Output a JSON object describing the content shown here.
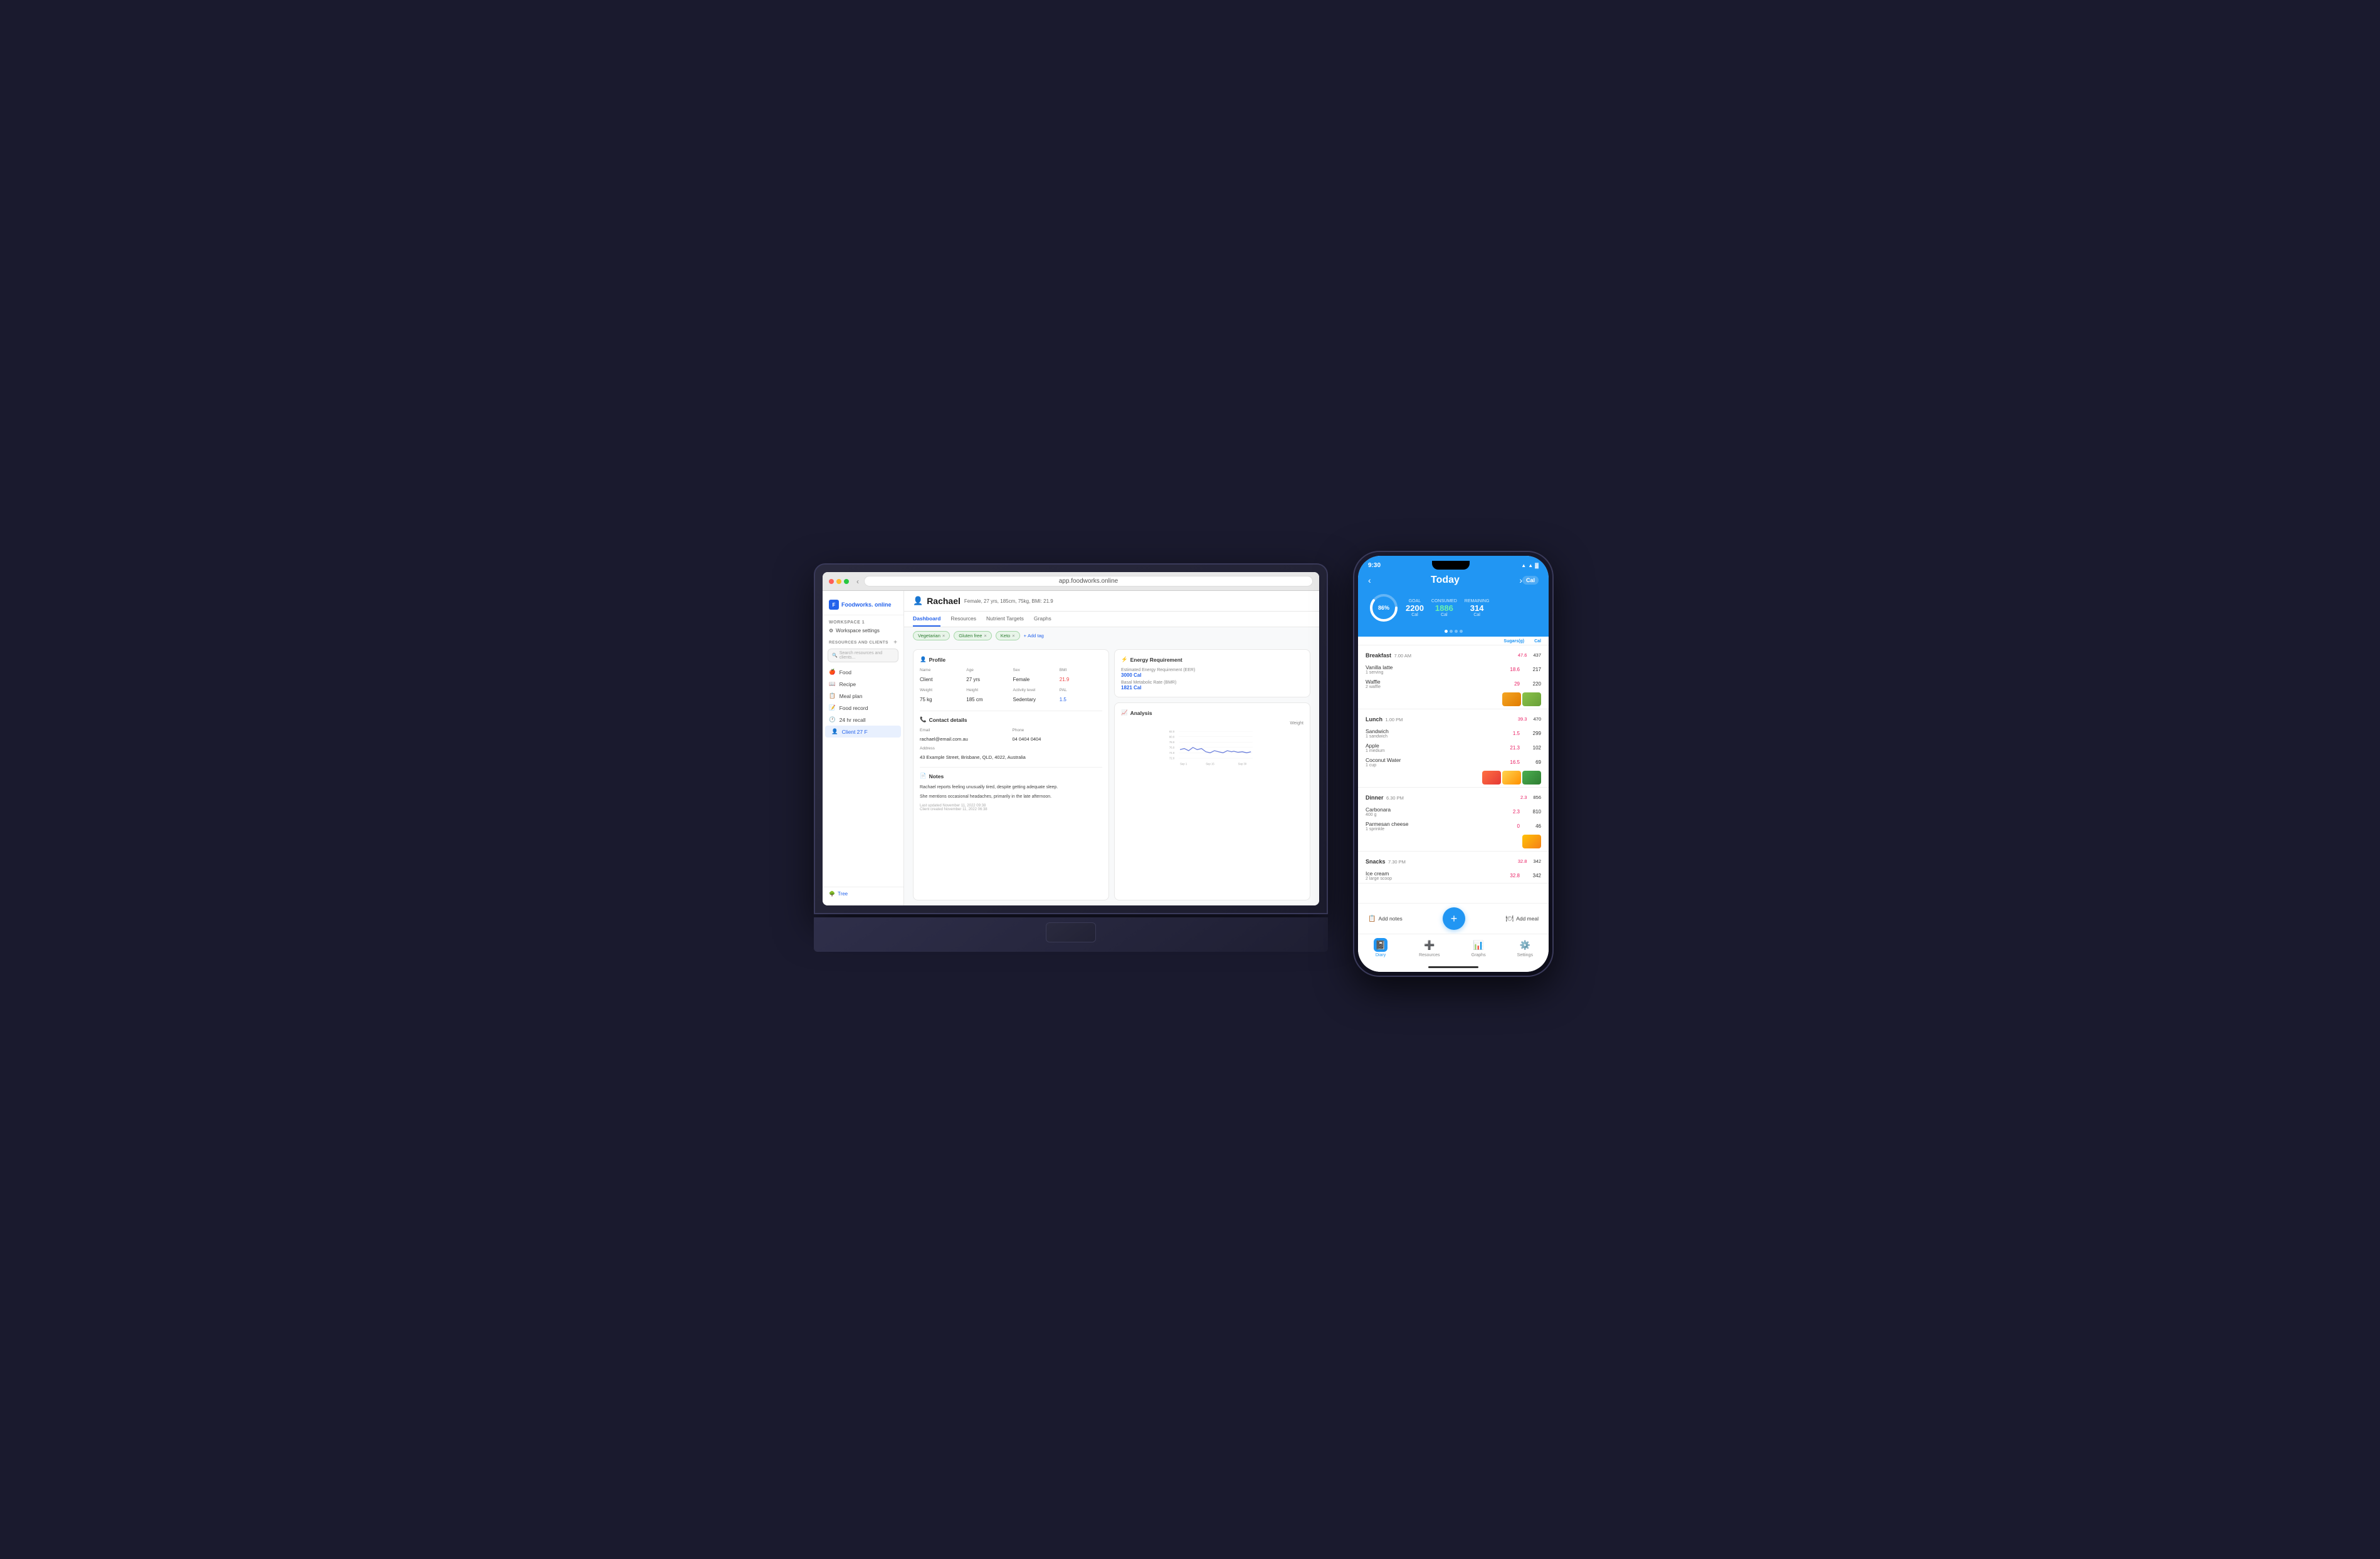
{
  "browser": {
    "url": "app.foodworks.online",
    "dots": [
      "red",
      "yellow",
      "green"
    ]
  },
  "sidebar": {
    "logo": "F",
    "brand": "Foodworks.",
    "brand_suffix": "online",
    "workspace_label": "WORKSPACE 1",
    "workspace_settings": "Workspace settings",
    "resources_label": "RESOURCES AND CLIENTS",
    "search_placeholder": "Search resources and clients...",
    "nav_items": [
      {
        "label": "Food",
        "icon": "🍎"
      },
      {
        "label": "Recipe",
        "icon": "📖"
      },
      {
        "label": "Meal plan",
        "icon": "📋"
      },
      {
        "label": "Food record",
        "icon": "📝"
      },
      {
        "label": "24 hr recall",
        "icon": "🕐"
      },
      {
        "label": "Client 27 F",
        "icon": "👤",
        "active": true
      }
    ],
    "tree_label": "Tree"
  },
  "client": {
    "name": "Rachael",
    "details": "Female, 27 yrs, 185cm, 75kg, BMI: 21.9",
    "tabs": [
      "Dashboard",
      "Resources",
      "Nutrient Targets",
      "Graphs"
    ],
    "active_tab": "Dashboard",
    "tags": [
      "Vegetarian",
      "Gluten free",
      "Keto"
    ],
    "add_tag": "+ Add tag"
  },
  "profile": {
    "title": "Profile",
    "fields": [
      {
        "label": "Name",
        "value": "Client"
      },
      {
        "label": "Age",
        "value": "27 yrs"
      },
      {
        "label": "Sex",
        "value": "Female"
      },
      {
        "label": "BMI",
        "value": "21.9",
        "highlight": true
      }
    ],
    "fields2": [
      {
        "label": "Weight",
        "value": "75 kg"
      },
      {
        "label": "Height",
        "value": "185 cm"
      },
      {
        "label": "Activity level",
        "value": "Sedentary"
      },
      {
        "label": "PAL",
        "value": "1.5",
        "highlight": true
      }
    ]
  },
  "contact": {
    "title": "Contact details",
    "email_label": "Email",
    "email": "rachael@email.com.au",
    "phone_label": "Phone",
    "phone": "04 0404 0404",
    "address_label": "Address",
    "address": "43 Example Street, Brisbane, QLD, 4022, Australia"
  },
  "notes": {
    "title": "Notes",
    "content_1": "Rachael reports feeling unusually tired, despite getting adequate sleep.",
    "content_2": "She mentions occasional headaches, primarily in the late afternoon.",
    "last_updated": "Last updated November 11, 2022 09:38",
    "created": "Client created November 11, 2022 06:38"
  },
  "energy": {
    "title": "Energy Requirement",
    "eer_label": "Estimated Energy Requirement (EER)",
    "eer_value": "3000 Cal",
    "bmr_label": "Basal Metabolic Rate (BMR)",
    "bmr_value": "1821 Cal"
  },
  "analysis": {
    "title": "Analysis",
    "chart_label": "Weight",
    "y_label": "Weight (kg)",
    "dates": [
      "Sep 1",
      "Sep 15",
      "Sep 30"
    ],
    "y_range": [
      "68.0",
      "70.0",
      "72.0",
      "74.0",
      "76.0",
      "78.0",
      "80.0",
      "82.0"
    ]
  },
  "phone": {
    "status_time": "9:30",
    "header_title": "Today",
    "cal_btn": "Cal",
    "goal_label": "GOAL",
    "goal_value": "2200 Cal",
    "consumed_label": "CONSUMED",
    "consumed_value": "1886 Cal",
    "remaining_label": "REMAINING",
    "remaining_value": "314 Cal",
    "progress_pct": "86%",
    "col_sugars": "Sugars(g)",
    "col_cal": "Cal",
    "meals": [
      {
        "name": "Breakfast",
        "time": "7.00 AM",
        "sugar": "47.6",
        "cal": "437",
        "items": [
          {
            "name": "Vanilla latte",
            "desc": "1 serving",
            "sugar": "18.6",
            "cal": "217"
          },
          {
            "name": "Waffle",
            "desc": "2 waffle",
            "sugar": "29",
            "cal": "220"
          }
        ],
        "thumbs": [
          "waffle",
          "waffle2"
        ]
      },
      {
        "name": "Lunch",
        "time": "1.00 PM",
        "sugar": "39.3",
        "cal": "470",
        "items": [
          {
            "name": "Sandwich",
            "desc": "1 sandwich",
            "sugar": "1.5",
            "cal": "299"
          },
          {
            "name": "Apple",
            "desc": "1 medium",
            "sugar": "21.3",
            "cal": "102"
          },
          {
            "name": "Coconut Water",
            "desc": "1 cup",
            "sugar": "16.5",
            "cal": "69"
          }
        ],
        "thumbs": [
          "sandwich",
          "sandwich2",
          "sandwich3"
        ]
      },
      {
        "name": "Dinner",
        "time": "6.30 PM",
        "sugar": "2.3",
        "cal": "856",
        "items": [
          {
            "name": "Carbonara",
            "desc": "400 g",
            "sugar": "2.3",
            "cal": "810"
          },
          {
            "name": "Parmesan cheese",
            "desc": "1 sprinkle",
            "sugar": "0",
            "cal": "46"
          }
        ],
        "thumbs": [
          "carbonara"
        ]
      },
      {
        "name": "Snacks",
        "time": "7.30 PM",
        "sugar": "32.8",
        "cal": "342",
        "items": [
          {
            "name": "Ice cream",
            "desc": "2 large scoop",
            "sugar": "32.8",
            "cal": "342"
          }
        ],
        "thumbs": []
      }
    ],
    "add_notes": "Add notes",
    "add_meal": "Add meal",
    "tabs": [
      {
        "label": "Diary",
        "icon": "📓",
        "active": true
      },
      {
        "label": "Resources",
        "icon": "➕"
      },
      {
        "label": "Graphs",
        "icon": "📊"
      },
      {
        "label": "Settings",
        "icon": "⚙️"
      }
    ]
  }
}
